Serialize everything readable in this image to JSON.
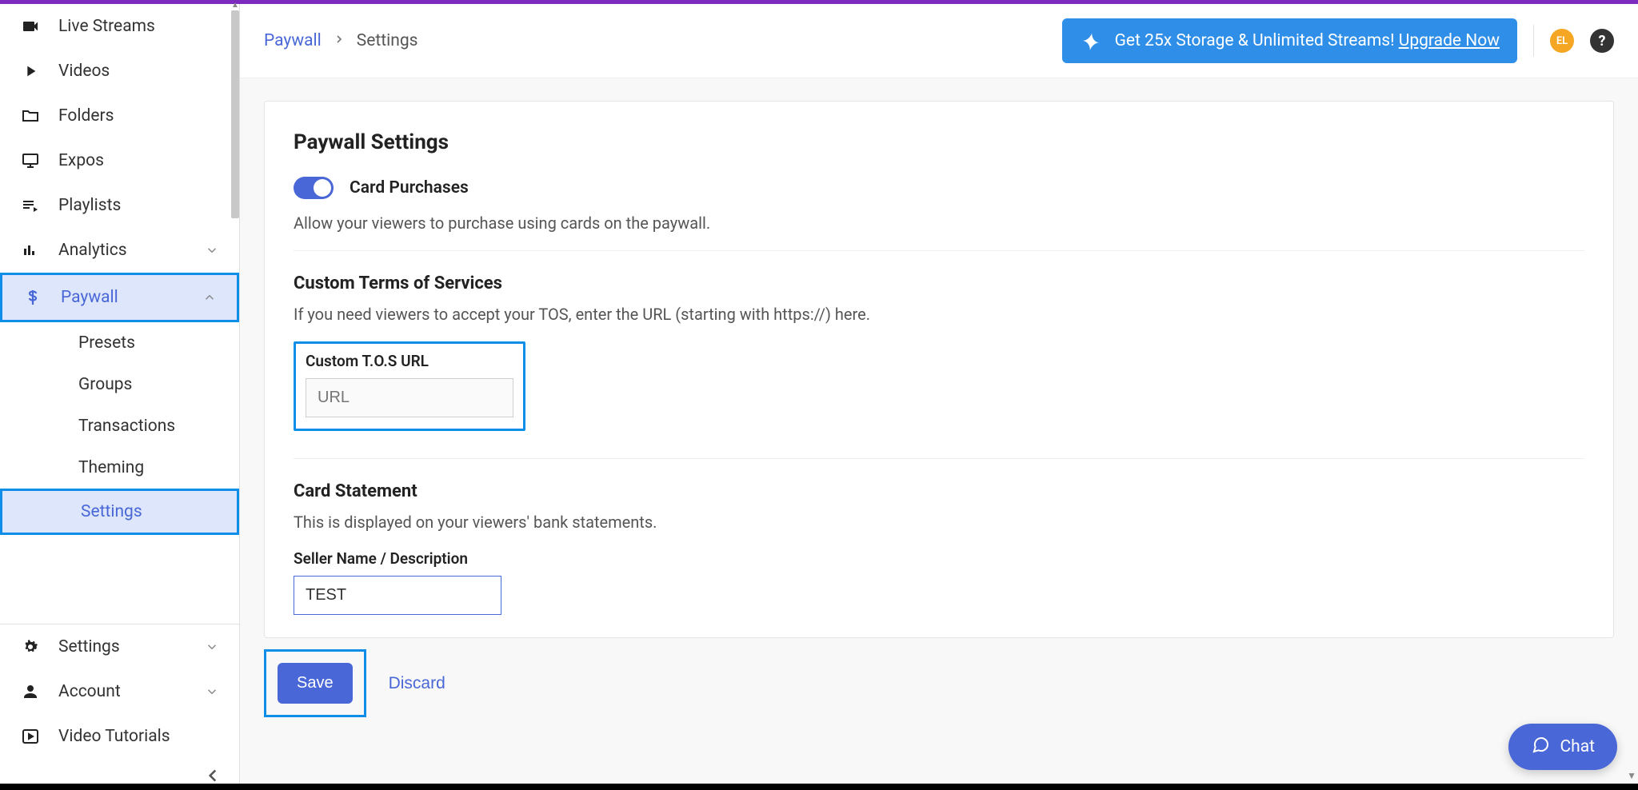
{
  "sidebar": {
    "items": [
      {
        "label": "Live Streams"
      },
      {
        "label": "Videos"
      },
      {
        "label": "Folders"
      },
      {
        "label": "Expos"
      },
      {
        "label": "Playlists"
      },
      {
        "label": "Analytics"
      },
      {
        "label": "Paywall"
      }
    ],
    "paywall_sub": [
      {
        "label": "Presets"
      },
      {
        "label": "Groups"
      },
      {
        "label": "Transactions"
      },
      {
        "label": "Theming"
      },
      {
        "label": "Settings"
      }
    ],
    "bottom": [
      {
        "label": "Settings"
      },
      {
        "label": "Account"
      },
      {
        "label": "Video Tutorials"
      }
    ]
  },
  "breadcrumb": {
    "link": "Paywall",
    "current": "Settings"
  },
  "banner": {
    "text": "Get 25x Storage & Unlimited Streams! ",
    "cta": "Upgrade Now"
  },
  "avatar": "EL",
  "page": {
    "title": "Paywall Settings",
    "card_purchases": {
      "label": "Card Purchases",
      "desc": "Allow your viewers to purchase using cards on the paywall."
    },
    "tos": {
      "title": "Custom Terms of Services",
      "desc": "If you need viewers to accept your TOS, enter the URL (starting with https://) here.",
      "field_label": "Custom T.O.S URL",
      "placeholder": "URL",
      "value": ""
    },
    "statement": {
      "title": "Card Statement",
      "desc": "This is displayed on your viewers' bank statements.",
      "field_label": "Seller Name / Description",
      "value": "TEST"
    },
    "actions": {
      "save": "Save",
      "discard": "Discard"
    }
  },
  "chat": "Chat"
}
